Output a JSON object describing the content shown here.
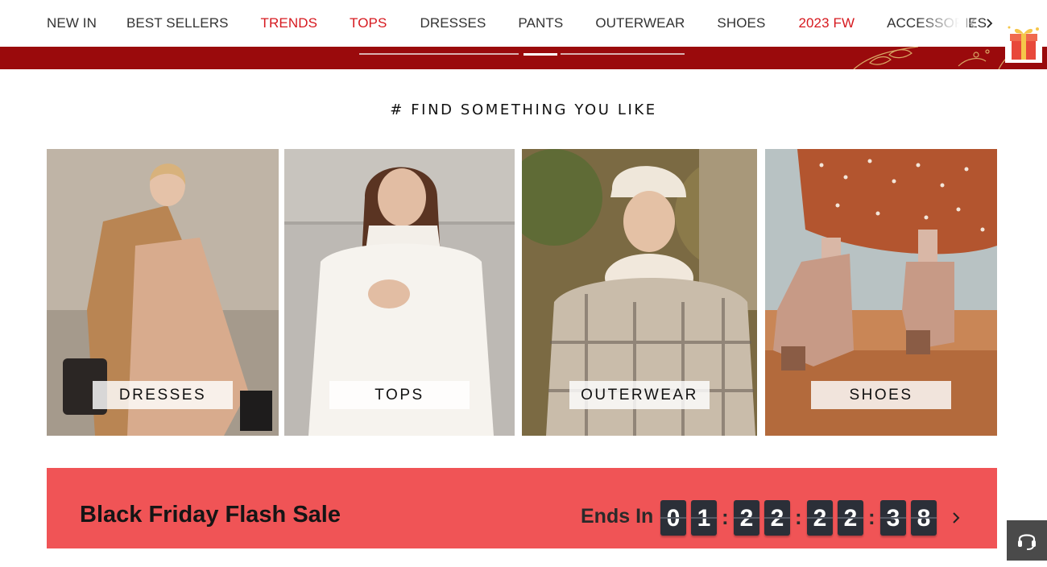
{
  "nav": {
    "items": [
      {
        "label": "NEW IN",
        "color": "#333333"
      },
      {
        "label": "BEST SELLERS",
        "color": "#333333"
      },
      {
        "label": "TRENDS",
        "color": "#d6191f"
      },
      {
        "label": "TOPS",
        "color": "#d6191f"
      },
      {
        "label": "DRESSES",
        "color": "#333333"
      },
      {
        "label": "PANTS",
        "color": "#333333"
      },
      {
        "label": "OUTERWEAR",
        "color": "#333333"
      },
      {
        "label": "SHOES",
        "color": "#333333"
      },
      {
        "label": "2023 FW",
        "color": "#d6191f"
      },
      {
        "label": "ACCESSORIES",
        "color": "#333333"
      }
    ],
    "prev_icon": "chevron-left-icon",
    "next_icon": "chevron-right-icon",
    "gift_icon": "gift-box-icon"
  },
  "banner": {
    "background": "#9a0a0c",
    "slides": 3,
    "active_slide": 2
  },
  "section": {
    "title": "# FIND SOMETHING YOU LIKE"
  },
  "categories": [
    {
      "label": "DRESSES"
    },
    {
      "label": "TOPS"
    },
    {
      "label": "OUTERWEAR"
    },
    {
      "label": "SHOES"
    }
  ],
  "flash_sale": {
    "title": "Black Friday Flash Sale",
    "ends_label": "Ends In",
    "countdown": {
      "days": "01",
      "hours": "22",
      "minutes": "22",
      "seconds": "38"
    },
    "separator": ":",
    "background": "#f05456"
  },
  "support": {
    "icon": "headset-icon"
  }
}
